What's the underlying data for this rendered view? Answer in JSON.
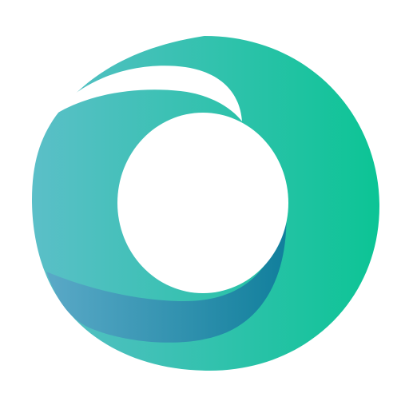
{
  "logo": {
    "icon": "teal-ring-wave-logo",
    "colors": {
      "background": "#ffffff",
      "ring_left": "#5bbfc8",
      "ring_right": "#0cc495",
      "wave_start": "#5aa9c7",
      "wave_end": "#117f9c",
      "hole": "#ffffff"
    }
  }
}
